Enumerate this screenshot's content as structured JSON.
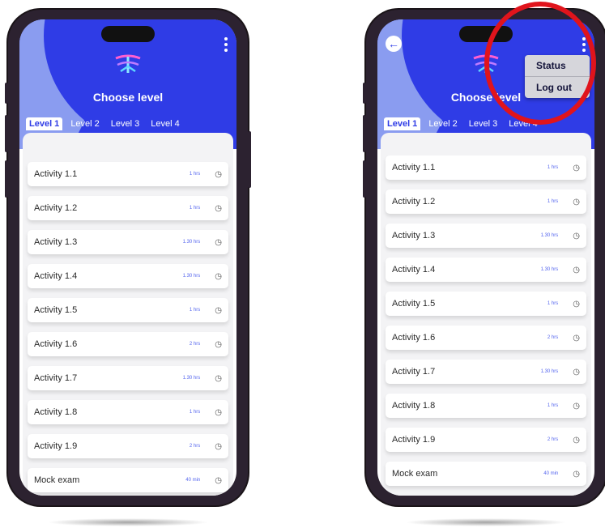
{
  "screens": [
    {
      "title": "Choose level",
      "tabs": [
        "Level 1",
        "Level 2",
        "Level 3",
        "Level 4"
      ],
      "active_tab": "Level 1",
      "activities": [
        {
          "name": "Activity 1.1",
          "duration": "1 hrs"
        },
        {
          "name": "Activity 1.2",
          "duration": "1 hrs"
        },
        {
          "name": "Activity 1.3",
          "duration": "1.30 hrs"
        },
        {
          "name": "Activity 1.4",
          "duration": "1.30 hrs"
        },
        {
          "name": "Activity 1.5",
          "duration": "1 hrs"
        },
        {
          "name": "Activity 1.6",
          "duration": "2 hrs"
        },
        {
          "name": "Activity 1.7",
          "duration": "1.30 hrs"
        },
        {
          "name": "Activity 1.8",
          "duration": "1 hrs"
        },
        {
          "name": "Activity 1.9",
          "duration": "2 hrs"
        },
        {
          "name": "Mock exam",
          "duration": "40 min"
        }
      ],
      "menu_icon": "kebab-menu-icon",
      "row_icon": "clock-icon"
    },
    {
      "title": "Choose level",
      "tabs": [
        "Level 1",
        "Level 2",
        "Level 3",
        "Level 4"
      ],
      "active_tab": "Level 1",
      "activities": [
        {
          "name": "Activity 1.1",
          "duration": "1 hrs"
        },
        {
          "name": "Activity 1.2",
          "duration": "1 hrs"
        },
        {
          "name": "Activity 1.3",
          "duration": "1.30 hrs"
        },
        {
          "name": "Activity 1.4",
          "duration": "1.30 hrs"
        },
        {
          "name": "Activity 1.5",
          "duration": "1 hrs"
        },
        {
          "name": "Activity 1.6",
          "duration": "2 hrs"
        },
        {
          "name": "Activity 1.7",
          "duration": "1.30 hrs"
        },
        {
          "name": "Activity 1.8",
          "duration": "1 hrs"
        },
        {
          "name": "Activity 1.9",
          "duration": "2 hrs"
        },
        {
          "name": "Mock exam",
          "duration": "40 min"
        }
      ],
      "dropdown_menu": [
        "Status",
        "Log out"
      ],
      "back_icon": "back-arrow-icon"
    }
  ],
  "colors": {
    "header_blue": "#2f3ce6",
    "header_light": "#8a9cf0",
    "highlight_ring": "#e0141c",
    "phone_frame": "#2c2230"
  }
}
